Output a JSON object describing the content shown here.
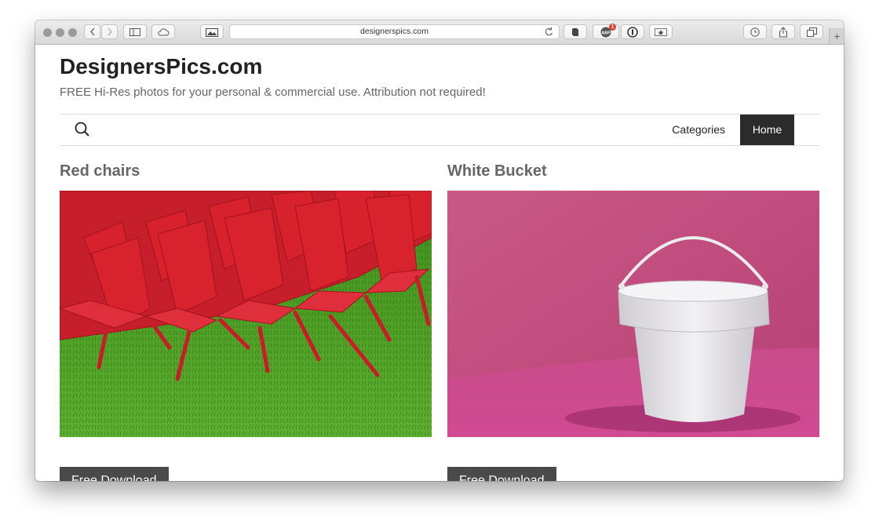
{
  "browser": {
    "url": "designerspics.com",
    "adblock_count": "1"
  },
  "site": {
    "title": "DesignersPics.com",
    "tagline": "FREE Hi-Res photos for your personal & commercial use. Attribution not required!"
  },
  "nav": {
    "items": [
      "Categories",
      "Home"
    ],
    "active": "Home"
  },
  "posts": [
    {
      "title": "Red chairs",
      "button": "Free Download"
    },
    {
      "title": "White Bucket",
      "button": "Free Download"
    }
  ],
  "colors": {
    "nav_active_bg": "#2b2b2b",
    "button_bg": "#4a4a4a",
    "title_text": "#222222"
  }
}
